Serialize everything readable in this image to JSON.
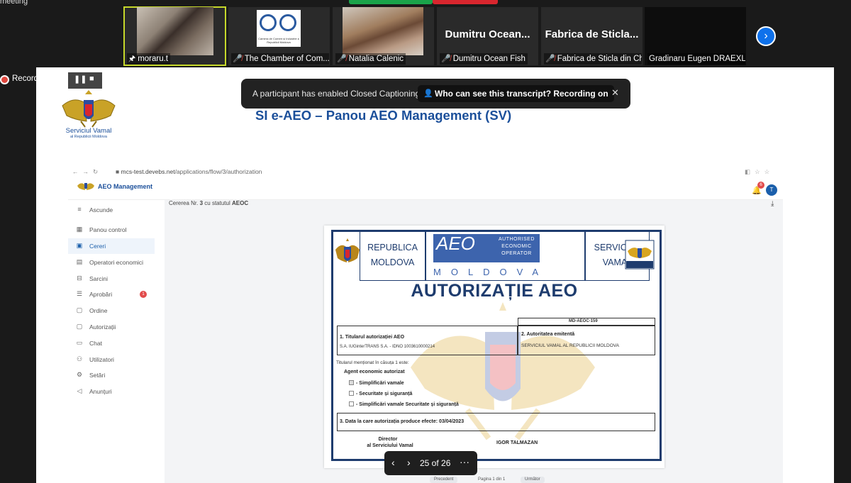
{
  "meeting": {
    "top_label": "meeting",
    "participants": [
      {
        "name": "moraru.t",
        "pinned": true,
        "muted": false
      },
      {
        "name": "The Chamber of Com...",
        "muted": true
      },
      {
        "name": "Natalia Calenic",
        "muted": true
      },
      {
        "name": "Dumitru Ocean Fish",
        "muted": true,
        "display": "Dumitru Ocean..."
      },
      {
        "name": "Fabrica de Sticla din Ch...",
        "muted": true,
        "display": "Fabrica de Sticla..."
      },
      {
        "name": "Gradinaru Eugen DRAEXL...",
        "muted": false
      }
    ],
    "chamber_logo_text": "Camera de Comerț și Industrie a Republicii Moldova",
    "recording_label": "Recording...",
    "cc_message": "A participant has enabled Closed Captioning",
    "cc_pill": "Who can see this transcript? Recording on",
    "page_indicator": "25 of 26"
  },
  "slide": {
    "org_name": "Serviciul Vamal",
    "org_sub": "al Republicii Moldova",
    "title": "SI e-AEO – Panou AEO Management (SV)"
  },
  "browser": {
    "url_host": "mcs-test.devebs.net",
    "url_path": "/applications/flow/3/authorization",
    "brand": "AEO Management",
    "bell_count": "6",
    "avatar_initial": "T",
    "sidebar": [
      {
        "icon": "≡",
        "label": "Ascunde"
      },
      {
        "icon": "▦",
        "label": "Panou control"
      },
      {
        "icon": "▣",
        "label": "Cereri",
        "active": true
      },
      {
        "icon": "▤",
        "label": "Operatori economici"
      },
      {
        "icon": "⊟",
        "label": "Sarcini"
      },
      {
        "icon": "☰",
        "label": "Aprobări",
        "badge": "1"
      },
      {
        "icon": "▢",
        "label": "Ordine"
      },
      {
        "icon": "▢",
        "label": "Autorizații"
      },
      {
        "icon": "▭",
        "label": "Chat"
      },
      {
        "icon": "⚇",
        "label": "Utilizatori"
      },
      {
        "icon": "⚙",
        "label": "Setări"
      },
      {
        "icon": "◁",
        "label": "Anunțuri"
      }
    ],
    "request_prefix": "Cererea Nr.",
    "request_no": "3",
    "request_mid": "cu statutul",
    "request_status": "AEOC"
  },
  "certificate": {
    "header_left": [
      "REPUBLICA",
      "MOLDOVA"
    ],
    "header_right": [
      "SERVICIUL",
      "VAMAL"
    ],
    "logo_letters": "AEO",
    "logo_small": [
      "AUTHORISED",
      "ECONOMIC",
      "OPERATOR"
    ],
    "logo_country": "MOLDOVA",
    "title": "AUTORIZAȚIE AEO",
    "cert_no": "MD-AEOC-159",
    "holder_label": "1. Titularul autorizației AEO",
    "holder_value": "S.A. IUGinterTRANS S.A. - IDNO 1003610000214",
    "issuer_label": "2. Autoritatea emitentă",
    "issuer_value": "SERVICIUL VAMAL AL REPUBLICII MOLDOVA",
    "mentioned": "Titularul menționat în căsuța 1 este:",
    "agent": "Agent economic autorizat",
    "options": [
      {
        "label": "- Simplificări vamale",
        "checked": true
      },
      {
        "label": "- Securitate și siguranță",
        "checked": false
      },
      {
        "label": "- Simplificări vamale Securitate și siguranță",
        "checked": false
      }
    ],
    "effective": "3. Data la care autorizația produce efecte: 03/04/2023",
    "director_line1": "Director",
    "director_line2": "al Serviciului Vamal",
    "director_name": "IGOR TALMAZAN"
  },
  "bottom_buttons": [
    "Precedent",
    "Pagina 1 din 1",
    "Următor"
  ]
}
